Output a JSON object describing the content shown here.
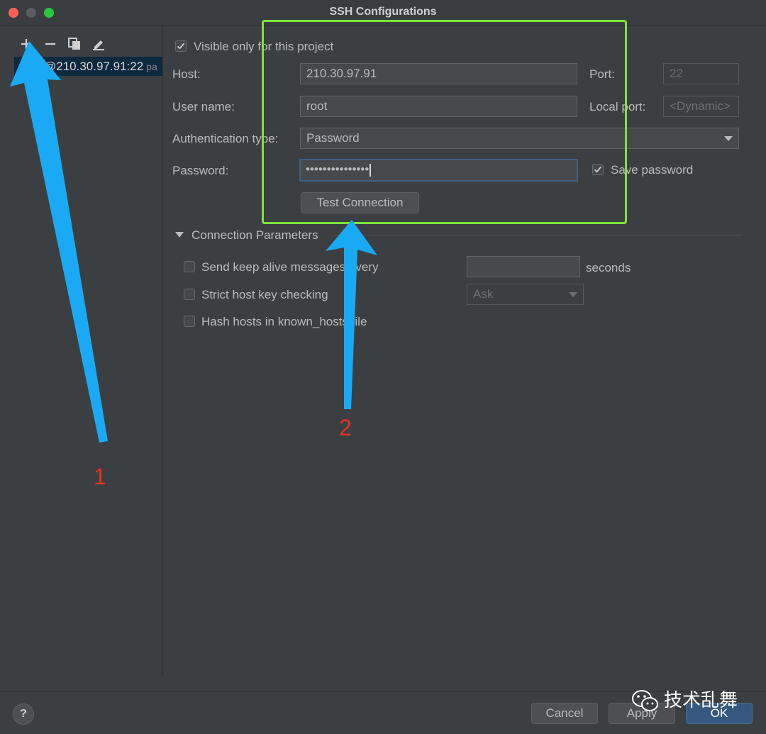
{
  "window": {
    "title": "SSH Configurations"
  },
  "colors": {
    "annotation_box": "#7de33c",
    "arrow": "#1aaaf5",
    "annotation_number": "#e8321f",
    "selection": "#0d293e"
  },
  "toolbar": {
    "icons": [
      "add-icon",
      "remove-icon",
      "copy-icon",
      "edit-icon"
    ],
    "add": "+",
    "remove": "−"
  },
  "config_list": {
    "selected_item": "@210.30.97.91:22",
    "selected_item_suffix": "pa"
  },
  "form": {
    "visible_only_label": "Visible only for this project",
    "visible_only_checked": true,
    "host_label": "Host:",
    "host_value": "210.30.97.91",
    "port_label": "Port:",
    "port_value": "22",
    "user_label": "User name:",
    "user_value": "root",
    "local_port_label": "Local port:",
    "local_port_placeholder": "<Dynamic>",
    "auth_label": "Authentication type:",
    "auth_value": "Password",
    "password_label": "Password:",
    "password_value": "•••••••••••••••",
    "save_password_label": "Save password",
    "save_password_checked": true,
    "test_connection": "Test Connection"
  },
  "connection_params": {
    "section_title": "Connection Parameters",
    "keep_alive_label": "Send keep alive messages every",
    "keep_alive_checked": false,
    "seconds_unit": "seconds",
    "strict_host_label": "Strict host key checking",
    "strict_host_checked": false,
    "strict_host_value": "Ask",
    "hash_hosts_label": "Hash hosts in known_hosts file",
    "hash_hosts_checked": false
  },
  "footer": {
    "help": "?",
    "cancel": "Cancel",
    "apply": "Apply",
    "ok": "OK"
  },
  "annotations": {
    "arrow1_number": "1",
    "arrow2_number": "2"
  },
  "watermark": {
    "text": "技术乱舞"
  }
}
